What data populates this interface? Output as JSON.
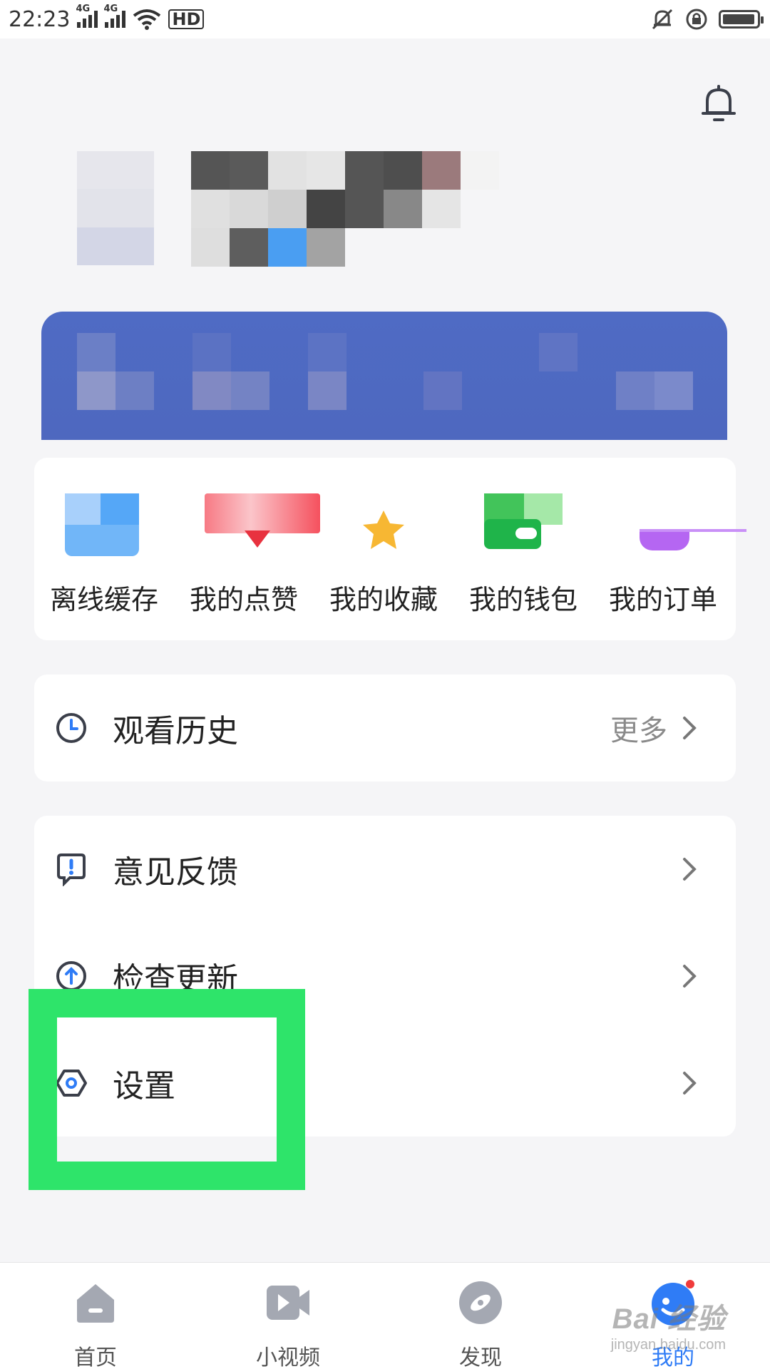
{
  "status_bar": {
    "time": "22:23",
    "signal_1": "4G",
    "signal_2": "4G",
    "hd": "HD"
  },
  "quick_actions": [
    {
      "label": "离线缓存",
      "icon": "offline-cache-icon"
    },
    {
      "label": "我的点赞",
      "icon": "likes-icon"
    },
    {
      "label": "我的收藏",
      "icon": "favorites-star-icon"
    },
    {
      "label": "我的钱包",
      "icon": "wallet-icon"
    },
    {
      "label": "我的订单",
      "icon": "orders-icon"
    }
  ],
  "history": {
    "label": "观看历史",
    "more": "更多"
  },
  "menu": [
    {
      "label": "意见反馈",
      "icon": "feedback-icon"
    },
    {
      "label": "检查更新",
      "icon": "update-icon"
    },
    {
      "label": "设置",
      "icon": "settings-icon"
    }
  ],
  "bottom_nav": [
    {
      "label": "首页",
      "icon": "home-icon"
    },
    {
      "label": "小视频",
      "icon": "short-video-icon"
    },
    {
      "label": "发现",
      "icon": "discover-icon"
    },
    {
      "label": "我的",
      "icon": "profile-icon",
      "active": true
    }
  ],
  "watermark": {
    "main": "Bai 经验",
    "sub": "jingyan.baidu.com"
  },
  "colors": {
    "accent": "#2f7cf6",
    "banner": "#4f6bc4",
    "highlight": "#2ee46a",
    "notification_dot": "#f03b3b"
  }
}
